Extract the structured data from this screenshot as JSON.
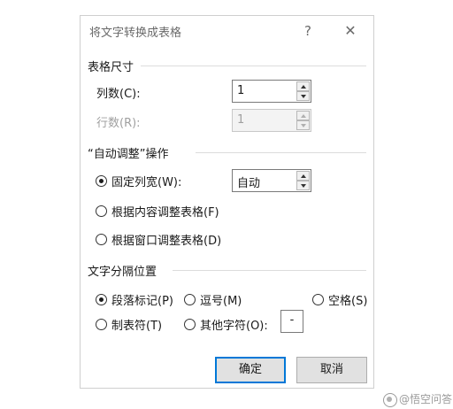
{
  "dialog": {
    "title": "将文字转换成表格",
    "help_glyph": "?",
    "close_glyph": "✕"
  },
  "table_size": {
    "heading": "表格尺寸",
    "columns_label": "列数(C):",
    "columns_value": "1",
    "rows_label": "行数(R):",
    "rows_value": "1"
  },
  "autofit": {
    "heading": "“自动调整”操作",
    "fixed_label": "固定列宽(W):",
    "fixed_value": "自动",
    "content_label": "根据内容调整表格(F)",
    "window_label": "根据窗口调整表格(D)",
    "selected": "fixed"
  },
  "separator": {
    "heading": "文字分隔位置",
    "paragraph_label": "段落标记(P)",
    "comma_label": "逗号(M)",
    "space_label": "空格(S)",
    "tab_label": "制表符(T)",
    "other_label": "其他字符(O):",
    "other_value": "-",
    "selected": "paragraph"
  },
  "buttons": {
    "ok_label": "确定",
    "cancel_label": "取消"
  },
  "watermark": {
    "text": "@悟空问答"
  },
  "colors": {
    "accent": "#0078d7",
    "button_bg": "#e1e1e1",
    "disabled_text": "#a0a0a0"
  }
}
